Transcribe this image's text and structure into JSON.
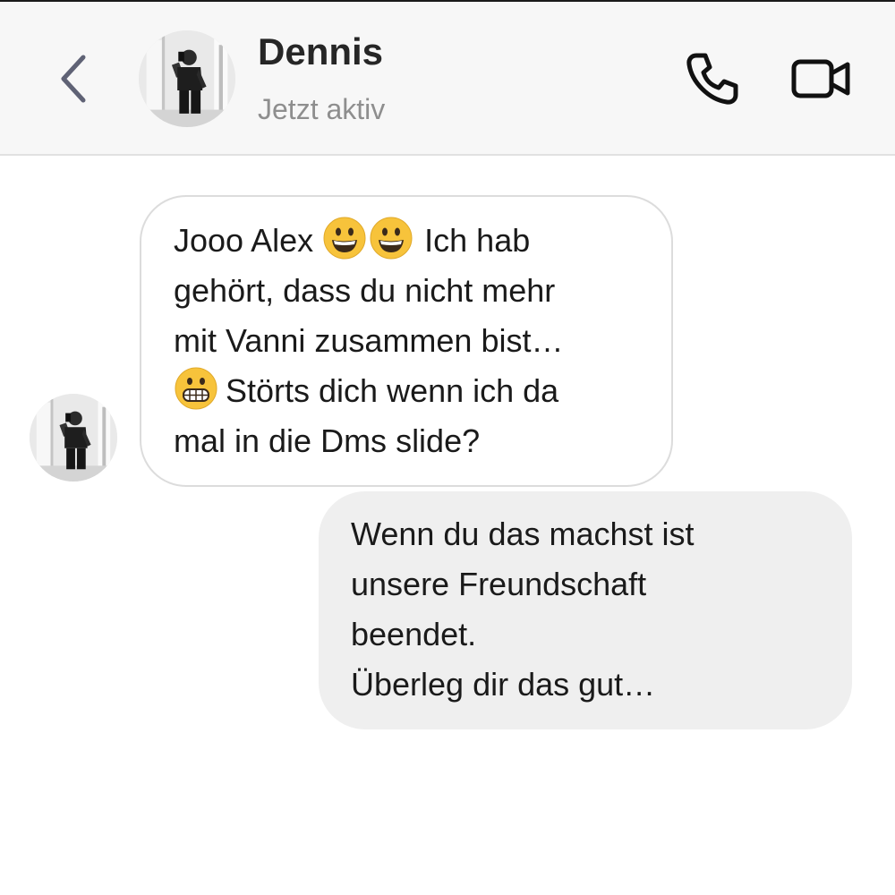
{
  "header": {
    "back_icon": "chevron-left-icon",
    "contact_name": "Dennis",
    "contact_status": "Jetzt aktiv",
    "call_icon": "phone-icon",
    "video_icon": "video-camera-icon"
  },
  "messages": [
    {
      "direction": "incoming",
      "sender": "Dennis",
      "lines": [
        "Jooo Alex",
        "Ich hab",
        "gehört, dass du nicht mehr",
        "mit Vanni zusammen bist…",
        "Störts dich wenn ich da",
        "mal in die Dms slide?"
      ],
      "emoji": [
        "grinning-face-emoji",
        "grinning-face-emoji",
        "grimacing-face-emoji"
      ]
    },
    {
      "direction": "outgoing",
      "lines": [
        "Wenn du das machst ist",
        "unsere Freundschaft",
        "beendet.",
        "Überleg dir das gut…"
      ]
    }
  ],
  "colors": {
    "header_bg": "#f7f7f7",
    "incoming_bubble_bg": "#ffffff",
    "incoming_bubble_border": "#dcdcdc",
    "outgoing_bubble_bg": "#efefef",
    "status_text": "#8e8e8e",
    "back_icon": "#5f6275"
  }
}
